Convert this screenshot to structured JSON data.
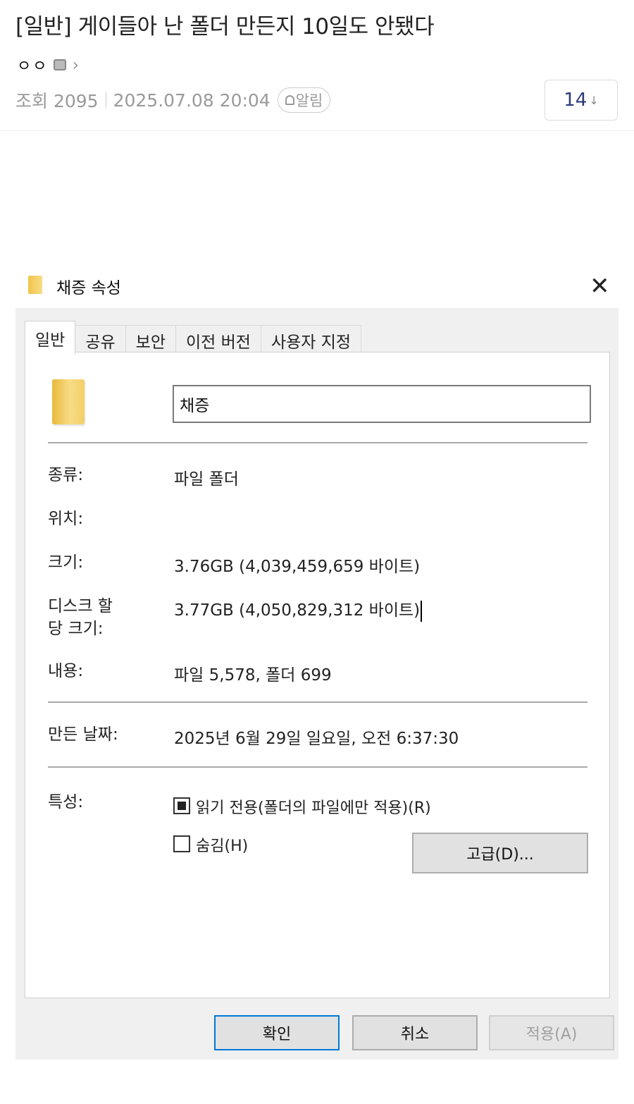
{
  "post": {
    "title": "[일반] 게이들아 난 폴더 만든지 10일도 안됐다",
    "author": "ㅇㅇ",
    "views_label": "조회 2095",
    "datetime": "2025.07.08 20:04",
    "alarm_label": "알림",
    "comment_count": "14",
    "comment_arrow": "↓"
  },
  "dialog": {
    "title": "채증 속성",
    "close_symbol": "✕",
    "tabs": [
      {
        "label": "일반",
        "active": true
      },
      {
        "label": "공유"
      },
      {
        "label": "보안"
      },
      {
        "label": "이전 버전"
      },
      {
        "label": "사용자 지정"
      }
    ],
    "name_value": "채증",
    "props": {
      "type_label": "종류:",
      "type_value": "파일 폴더",
      "location_label": "위치:",
      "location_value": "",
      "size_label": "크기:",
      "size_value": "3.76GB (4,039,459,659 바이트)",
      "disk_label": "디스크 할 당 크기:",
      "disk_value": "3.77GB (4,050,829,312 바이트)",
      "contents_label": "내용:",
      "contents_value": "파일 5,578, 폴더 699",
      "created_label": "만든 날짜:",
      "created_value": "2025년 6월 29일 일요일, 오전 6:37:30",
      "attributes_label": "특성:"
    },
    "attributes": {
      "readonly_label": "읽기 전용(폴더의 파일에만 적용)(R)",
      "readonly_state": "indeterminate",
      "hidden_label": "숨김(H)",
      "hidden_state": "unchecked",
      "advanced_label": "고급(D)..."
    },
    "buttons": {
      "ok": "확인",
      "cancel": "취소",
      "apply": "적용(A)"
    }
  }
}
